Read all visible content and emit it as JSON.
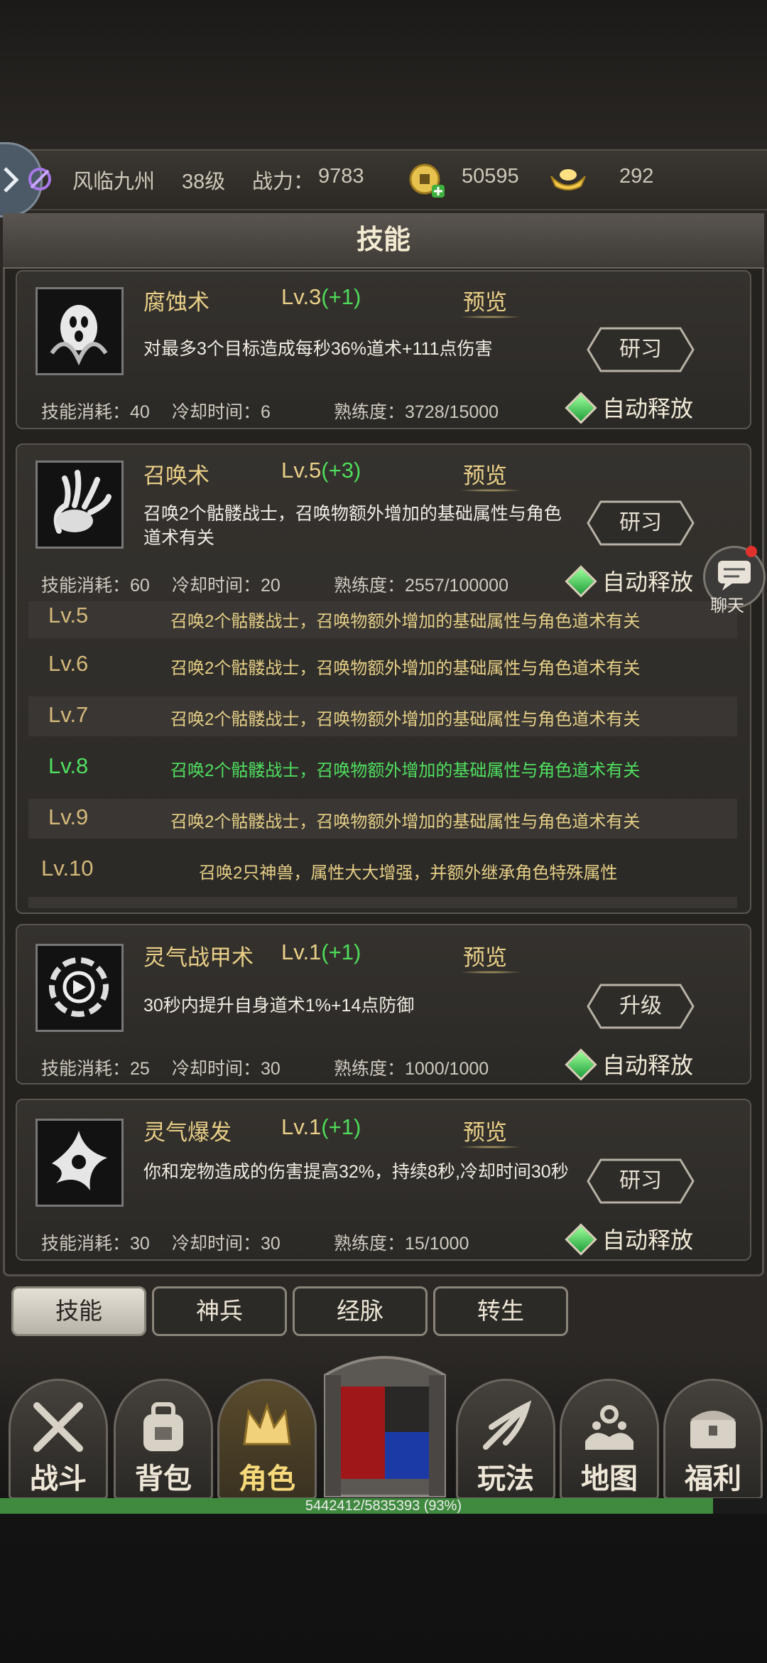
{
  "player": {
    "server": "风临九州",
    "level": "38级",
    "power_label": "战力：",
    "power_value": "9783",
    "copper": "50595",
    "gold": "292"
  },
  "panel_title": "技能",
  "skills": [
    {
      "name": "腐蚀术",
      "level": "Lv.3",
      "bonus": "(+1)",
      "preview": "预览",
      "desc": "对最多3个目标造成每秒36%道术+111点伤害",
      "cost": "技能消耗：40",
      "cooldown": "冷却时间：6",
      "proficiency": "熟练度：3728/15000",
      "button": "研习",
      "auto": "自动释放"
    },
    {
      "name": "召唤术",
      "level": "Lv.5",
      "bonus": "(+3)",
      "preview": "预览",
      "desc": "召唤2个骷髅战士，召唤物额外增加的基础属性与角色道术有关",
      "cost": "技能消耗：60",
      "cooldown": "冷却时间：20",
      "proficiency": "熟练度：2557/100000",
      "button": "研习",
      "auto": "自动释放"
    },
    {
      "name": "灵气战甲术",
      "level": "Lv.1",
      "bonus": "(+1)",
      "preview": "预览",
      "desc": "30秒内提升自身道术1%+14点防御",
      "cost": "技能消耗：25",
      "cooldown": "冷却时间：30",
      "proficiency": "熟练度：1000/1000",
      "button": "升级",
      "auto": "自动释放"
    },
    {
      "name": "灵气爆发",
      "level": "Lv.1",
      "bonus": "(+1)",
      "preview": "预览",
      "desc": "你和宠物造成的伤害提高32%，持续8秒,冷却时间30秒",
      "cost": "技能消耗：30",
      "cooldown": "冷却时间：30",
      "proficiency": "熟练度：15/1000",
      "button": "研习",
      "auto": "自动释放"
    }
  ],
  "level_table": [
    {
      "level": "Lv.5",
      "text": "召唤2个骷髅战士，召唤物额外增加的基础属性与角色道术有关"
    },
    {
      "level": "Lv.6",
      "text": "召唤2个骷髅战士，召唤物额外增加的基础属性与角色道术有关"
    },
    {
      "level": "Lv.7",
      "text": "召唤2个骷髅战士，召唤物额外增加的基础属性与角色道术有关"
    },
    {
      "level": "Lv.8",
      "text": "召唤2个骷髅战士，召唤物额外增加的基础属性与角色道术有关"
    },
    {
      "level": "Lv.9",
      "text": "召唤2个骷髅战士，召唤物额外增加的基础属性与角色道术有关"
    },
    {
      "level": "Lv.10",
      "text": "召唤2只神兽，属性大大增强，并额外继承角色特殊属性"
    }
  ],
  "level_table_highlight_color": "#4fe060",
  "chat_label": "聊天",
  "tabs": [
    "技能",
    "神兵",
    "经脉",
    "转生"
  ],
  "nav": [
    "战斗",
    "背包",
    "角色",
    "玩法",
    "地图",
    "福利"
  ],
  "exp": {
    "text": "5442412/5835393 (93%)",
    "fraction": 0.93
  }
}
